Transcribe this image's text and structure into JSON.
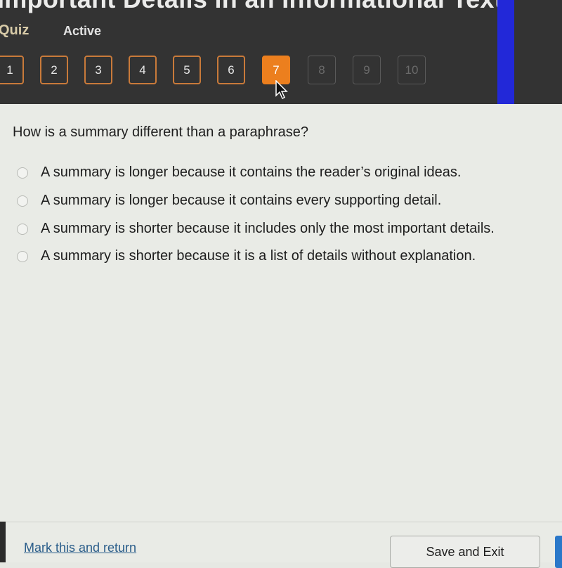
{
  "header": {
    "title": "Important Details in an Informational Text",
    "activity_type": "Quiz",
    "status": "Active"
  },
  "question_nav": [
    {
      "label": "1",
      "state": "answered"
    },
    {
      "label": "2",
      "state": "answered"
    },
    {
      "label": "3",
      "state": "answered"
    },
    {
      "label": "4",
      "state": "answered"
    },
    {
      "label": "5",
      "state": "answered"
    },
    {
      "label": "6",
      "state": "answered"
    },
    {
      "label": "7",
      "state": "current"
    },
    {
      "label": "8",
      "state": "locked"
    },
    {
      "label": "9",
      "state": "locked"
    },
    {
      "label": "10",
      "state": "locked"
    }
  ],
  "question": {
    "prompt": "How is a summary different than a paraphrase?",
    "options": [
      "A summary is longer because it contains the reader’s original ideas.",
      "A summary is longer because it contains every supporting detail.",
      "A summary is shorter because it includes only the most important details.",
      "A summary is shorter because it is a list of details without explanation."
    ]
  },
  "footer": {
    "mark_link": "Mark this and return",
    "save_button": "Save and Exit"
  },
  "colors": {
    "accent_orange": "#ec7f1e",
    "header_bg": "#333333",
    "link_blue": "#2a5d8a"
  }
}
